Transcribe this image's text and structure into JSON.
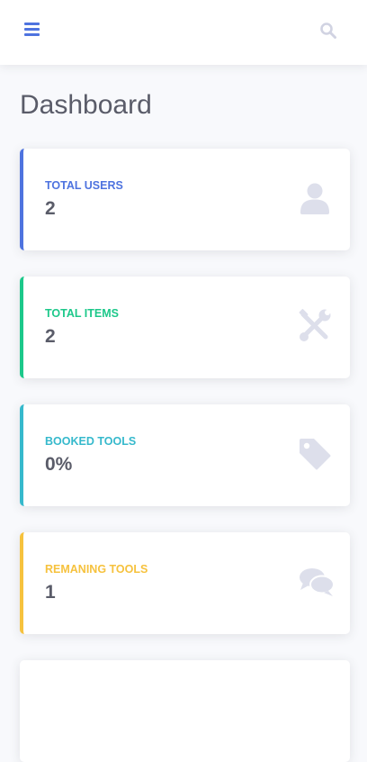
{
  "topbar": {
    "menu_icon": "bars-icon",
    "search_icon": "search-icon",
    "accent_color": "#4e73df"
  },
  "page": {
    "title": "Dashboard"
  },
  "cards": [
    {
      "label": "TOTAL USERS",
      "value": "2",
      "icon": "user-icon",
      "color": "#4e73df"
    },
    {
      "label": "TOTAL ITEMS",
      "value": "2",
      "icon": "tools-icon",
      "color": "#1cc88a"
    },
    {
      "label": "BOOKED TOOLS",
      "value": "0%",
      "icon": "tag-icon",
      "color": "#36b9cc"
    },
    {
      "label": "REMANING TOOLS",
      "value": "1",
      "icon": "comments-icon",
      "color": "#f6c23e"
    }
  ]
}
